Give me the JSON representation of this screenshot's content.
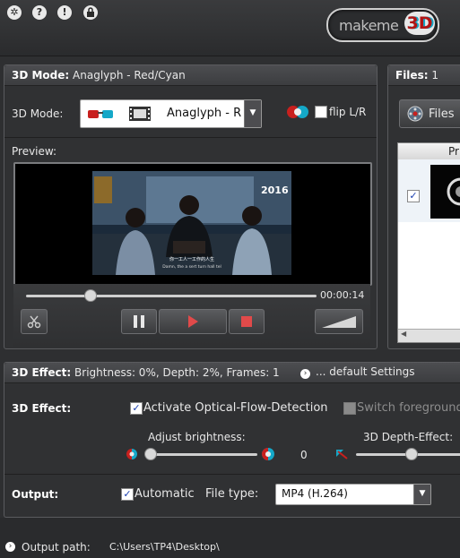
{
  "toolbar": {
    "icons": [
      "gear-icon",
      "help-icon",
      "info-icon",
      "lock-icon"
    ],
    "icon_glyphs": [
      "✲",
      "?",
      "!",
      "🔒"
    ]
  },
  "logo": {
    "text": "makeme",
    "badge": "3D"
  },
  "mode_panel": {
    "header_label": "3D Mode:",
    "header_value": "Anaglyph - Red/Cyan",
    "mode_label": "3D Mode:",
    "mode_selected": "Anaglyph - R",
    "flip_label": "flip L/R",
    "preview_label": "Preview:",
    "video_overlay_title": "2016",
    "video_subtitle_cn": "你一工人一工作的人生",
    "video_subtitle_en": "Damn, the a sert turn hall tel",
    "timecode": "00:00:14",
    "seek_progress": 0.22
  },
  "files_panel": {
    "header_label": "Files:",
    "count": "1",
    "files_button": "Files",
    "column_header": "Pr"
  },
  "effect_section": {
    "header_label": "3D Effect:",
    "header_value": "Brightness: 0%, Depth: 2%, Frames: 1",
    "default_settings": "... default Settings",
    "effect_label": "3D Effect:",
    "optical_flow_label": "Activate Optical-Flow-Detection",
    "switch_fg_label": "Switch foreground",
    "brightness_label": "Adjust brightness:",
    "brightness_value": "0",
    "depth_label": "3D Depth-Effect:"
  },
  "output_section": {
    "output_label": "Output:",
    "automatic_label": "Automatic",
    "filetype_label": "File type:",
    "filetype_selected": "MP4 (H.264)"
  },
  "footer": {
    "output_path_label": "Output path:",
    "output_path_value": "C:\\Users\\TP4\\Desktop\\"
  },
  "colors": {
    "accent_red": "#c8201e",
    "accent_cyan": "#14a8c8",
    "panel_bg": "#303133"
  }
}
